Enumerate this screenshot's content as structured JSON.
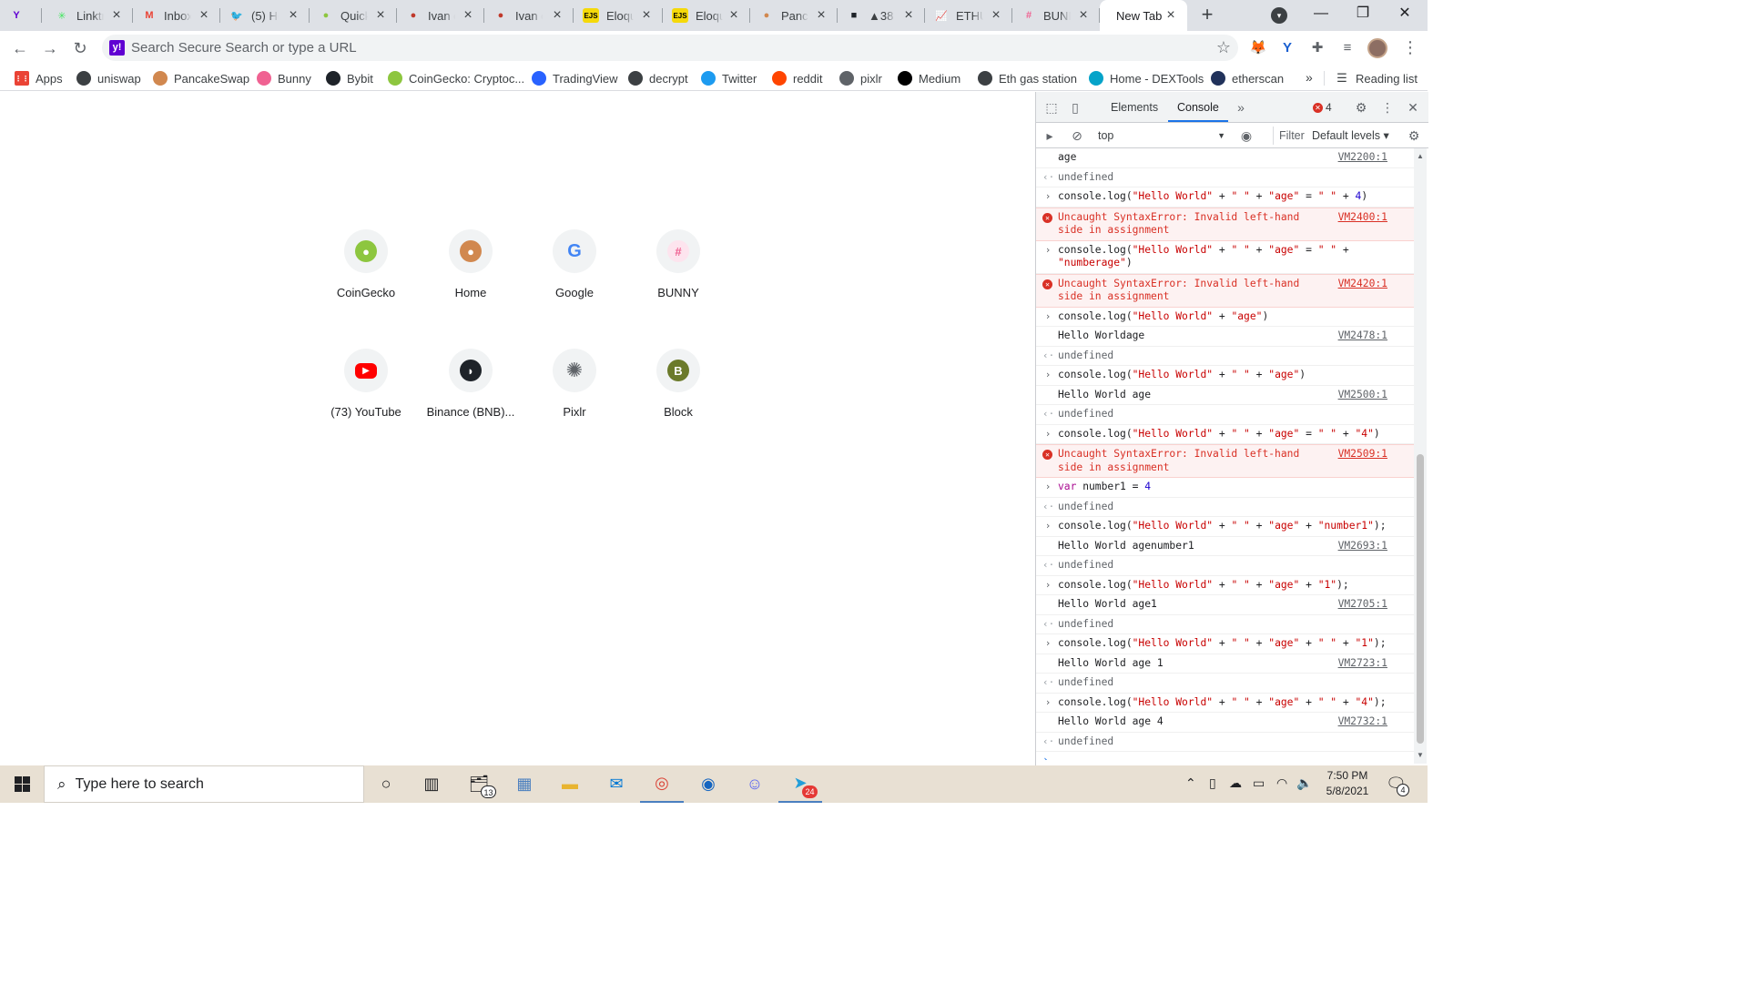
{
  "tabs": [
    {
      "title": "",
      "fav": "Y",
      "favColor": "#6001d2"
    },
    {
      "title": "Linktr",
      "fav": "✳",
      "favColor": "#43e660"
    },
    {
      "title": "Inbox",
      "fav": "M",
      "favColor": "#ea4335"
    },
    {
      "title": "(5) Ho",
      "fav": "🐦",
      "favColor": "#1d9bf0"
    },
    {
      "title": "Quick",
      "fav": "●",
      "favColor": "#8dc63f"
    },
    {
      "title": "Ivan c",
      "fav": "●",
      "favColor": "#c0392b"
    },
    {
      "title": "Ivan c",
      "fav": "●",
      "favColor": "#c0392b"
    },
    {
      "title": "Eloqu",
      "fav": "EJS",
      "favColor": "#f5d90a"
    },
    {
      "title": "Eloqu",
      "fav": "EJS",
      "favColor": "#f5d90a"
    },
    {
      "title": "Panca",
      "fav": "●",
      "favColor": "#d1884f"
    },
    {
      "title": "▲38",
      "fav": "■",
      "favColor": "#1e2329"
    },
    {
      "title": "ETHU",
      "fav": "📈",
      "favColor": "#2962ff"
    },
    {
      "title": "BUNN",
      "fav": "#",
      "favColor": "#f06292"
    }
  ],
  "active_tab": {
    "title": "New Tab"
  },
  "toolbar": {
    "omnibox_placeholder": "Search Secure Search or type a URL"
  },
  "bookmarks": [
    {
      "label": "Apps",
      "color": "#ea4335"
    },
    {
      "label": "uniswap",
      "color": "#3c4043"
    },
    {
      "label": "PancakeSwap",
      "color": "#d1884f"
    },
    {
      "label": "Bunny",
      "color": "#f06292"
    },
    {
      "label": "Bybit",
      "color": "#1e2329"
    },
    {
      "label": "CoinGecko: Cryptoc...",
      "color": "#8dc63f"
    },
    {
      "label": "TradingView",
      "color": "#2962ff"
    },
    {
      "label": "decrypt",
      "color": "#3c4043"
    },
    {
      "label": "Twitter",
      "color": "#1d9bf0"
    },
    {
      "label": "reddit",
      "color": "#ff4500"
    },
    {
      "label": "pixlr",
      "color": "#5f6368"
    },
    {
      "label": "Medium",
      "color": "#000000"
    },
    {
      "label": "Eth gas station",
      "color": "#3c4043"
    },
    {
      "label": "Home - DEXTools",
      "color": "#05a3c9"
    },
    {
      "label": "etherscan",
      "color": "#21325b"
    }
  ],
  "reading_list": "Reading list",
  "shortcuts": [
    {
      "label": "CoinGecko",
      "icon": "●",
      "color": "#8dc63f"
    },
    {
      "label": "Home",
      "icon": "●",
      "color": "#d1884f"
    },
    {
      "label": "Google",
      "icon": "G",
      "color": "#4285f4"
    },
    {
      "label": "BUNNY",
      "icon": "#",
      "color": "#f06292"
    },
    {
      "label": "(73) YouTube",
      "icon": "▶",
      "color": "#ff0000"
    },
    {
      "label": "Binance (BNB)...",
      "icon": "◗",
      "color": "#1e2329"
    },
    {
      "label": "Pixlr",
      "icon": "✺",
      "color": "#5f6368"
    },
    {
      "label": "Block",
      "icon": "B",
      "color": "#6b7a2a"
    }
  ],
  "devtools": {
    "tab_elements": "Elements",
    "tab_console": "Console",
    "error_count": "4",
    "context": "top",
    "filter_placeholder": "Filter",
    "levels": "Default levels"
  },
  "console": [
    {
      "kind": "log",
      "text": "age",
      "src": "VM2200:1"
    },
    {
      "kind": "result",
      "text": "undefined"
    },
    {
      "kind": "input",
      "text": "console.log(\"Hello World\" + \" \" + \"age\" = \" \" + 4)"
    },
    {
      "kind": "error",
      "text": "Uncaught SyntaxError: Invalid left-hand side in assignment",
      "src": "VM2400:1"
    },
    {
      "kind": "input",
      "text": "console.log(\"Hello World\" + \" \" + \"age\" = \" \" + \"numberage\")"
    },
    {
      "kind": "error",
      "text": "Uncaught SyntaxError: Invalid left-hand side in assignment",
      "src": "VM2420:1"
    },
    {
      "kind": "input",
      "text": "console.log(\"Hello World\" + \"age\")"
    },
    {
      "kind": "log",
      "text": "Hello Worldage",
      "src": "VM2478:1"
    },
    {
      "kind": "result",
      "text": "undefined"
    },
    {
      "kind": "input",
      "text": "console.log(\"Hello World\" + \" \" + \"age\")"
    },
    {
      "kind": "log",
      "text": "Hello World age",
      "src": "VM2500:1"
    },
    {
      "kind": "result",
      "text": "undefined"
    },
    {
      "kind": "input",
      "text": "console.log(\"Hello World\" + \" \" + \"age\" = \" \" + \"4\")"
    },
    {
      "kind": "error",
      "text": "Uncaught SyntaxError: Invalid left-hand side in assignment",
      "src": "VM2509:1"
    },
    {
      "kind": "input",
      "text": "var number1 = 4"
    },
    {
      "kind": "result",
      "text": "undefined"
    },
    {
      "kind": "input",
      "text": "console.log(\"Hello World\" + \" \" + \"age\" + \"number1\");"
    },
    {
      "kind": "log",
      "text": "Hello World agenumber1",
      "src": "VM2693:1"
    },
    {
      "kind": "result",
      "text": "undefined"
    },
    {
      "kind": "input",
      "text": "console.log(\"Hello World\" + \" \" + \"age\" + \"1\");"
    },
    {
      "kind": "log",
      "text": "Hello World age1",
      "src": "VM2705:1"
    },
    {
      "kind": "result",
      "text": "undefined"
    },
    {
      "kind": "input",
      "text": "console.log(\"Hello World\" + \" \" + \"age\" + \" \" + \"1\");"
    },
    {
      "kind": "log",
      "text": "Hello World age 1",
      "src": "VM2723:1"
    },
    {
      "kind": "result",
      "text": "undefined"
    },
    {
      "kind": "input",
      "text": "console.log(\"Hello World\" + \" \" + \"age\" + \" \" + \"4\");"
    },
    {
      "kind": "log",
      "text": "Hello World age 4",
      "src": "VM2732:1"
    },
    {
      "kind": "result",
      "text": "undefined"
    }
  ],
  "taskbar": {
    "search_placeholder": "Type here to search",
    "mail_badge": "13",
    "telegram_badge": "24",
    "time": "7:50 PM",
    "date": "5/8/2021",
    "notif_count": "4"
  }
}
